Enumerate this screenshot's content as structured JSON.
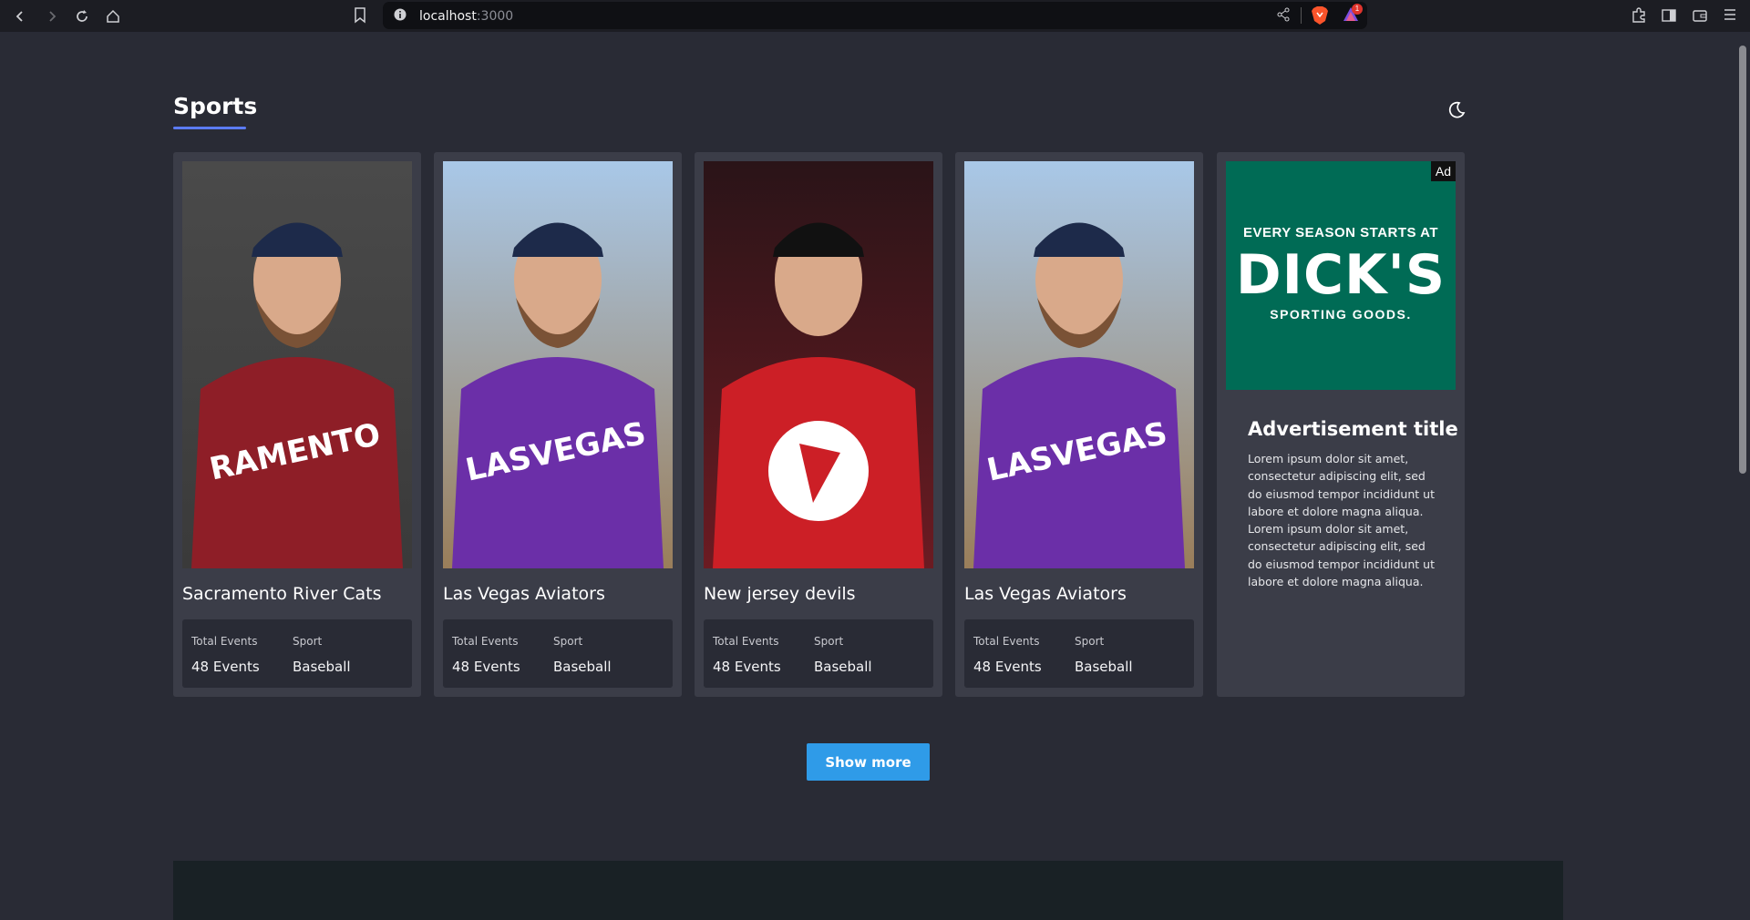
{
  "browser": {
    "url_host": "localhost",
    "url_port": ":3000",
    "rewards_badge": "1"
  },
  "page": {
    "title": "Sports",
    "show_more_label": "Show more"
  },
  "cards": [
    {
      "team": "Sacramento River Cats",
      "events_label": "Total Events",
      "events_value": "48 Events",
      "sport_label": "Sport",
      "sport_value": "Baseball",
      "jersey_color": "#8e1e27",
      "jersey_text": "RAMENTO"
    },
    {
      "team": "Las Vegas Aviators",
      "events_label": "Total Events",
      "events_value": "48 Events",
      "sport_label": "Sport",
      "sport_value": "Baseball",
      "jersey_color": "#6b2fa8",
      "jersey_text": "LASVEGAS"
    },
    {
      "team": "New jersey devils",
      "events_label": "Total Events",
      "events_value": "48 Events",
      "sport_label": "Sport",
      "sport_value": "Baseball",
      "jersey_color": "#cc1f26",
      "jersey_text": ""
    },
    {
      "team": "Las Vegas Aviators",
      "events_label": "Total Events",
      "events_value": "48 Events",
      "sport_label": "Sport",
      "sport_value": "Baseball",
      "jersey_color": "#6b2fa8",
      "jersey_text": "LASVEGAS"
    }
  ],
  "ad": {
    "badge": "Ad",
    "headline": "EVERY SEASON STARTS AT",
    "brand": "DICK'S",
    "sub": "SPORTING GOODS.",
    "title": "Advertisement title",
    "body": "Lorem ipsum dolor sit amet, consectetur adipiscing elit, sed do eiusmod tempor incididunt ut labore et dolore magna aliqua. Lorem ipsum dolor sit amet, consectetur adipiscing elit, sed do eiusmod tempor incididunt ut labore et dolore magna aliqua."
  },
  "colors": {
    "background": "#292b35",
    "card": "#3b3d48",
    "accent": "#5c7cfa",
    "button": "#2f9be8",
    "ad_green": "#006b55"
  }
}
